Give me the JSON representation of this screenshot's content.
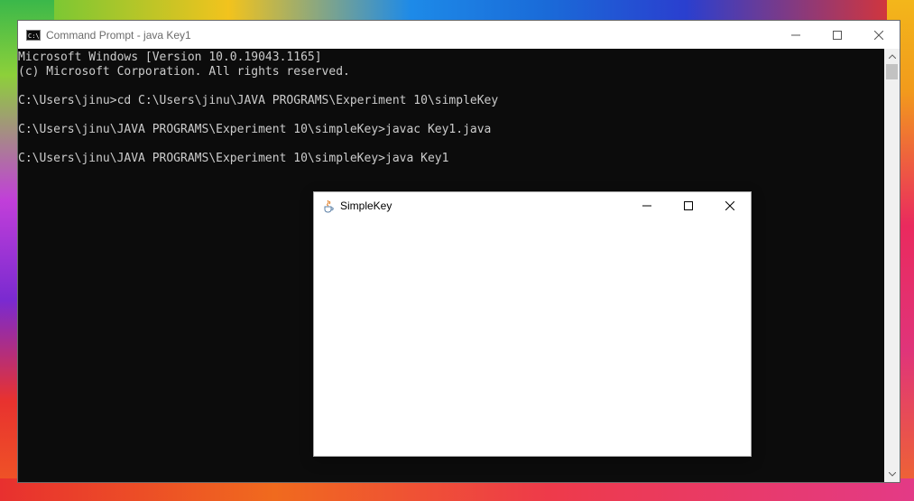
{
  "cmd": {
    "title": "Command Prompt - java  Key1",
    "icon_text": "C:\\",
    "lines": [
      "Microsoft Windows [Version 10.0.19043.1165]",
      "(c) Microsoft Corporation. All rights reserved.",
      "",
      "C:\\Users\\jinu>cd C:\\Users\\jinu\\JAVA PROGRAMS\\Experiment 10\\simpleKey",
      "",
      "C:\\Users\\jinu\\JAVA PROGRAMS\\Experiment 10\\simpleKey>javac Key1.java",
      "",
      "C:\\Users\\jinu\\JAVA PROGRAMS\\Experiment 10\\simpleKey>java Key1"
    ]
  },
  "java_window": {
    "title": "SimpleKey"
  },
  "icons": {
    "cmd": "command-prompt-icon",
    "java": "java-cup-icon",
    "minimize": "minimize-icon",
    "maximize": "maximize-icon",
    "close": "close-icon"
  }
}
